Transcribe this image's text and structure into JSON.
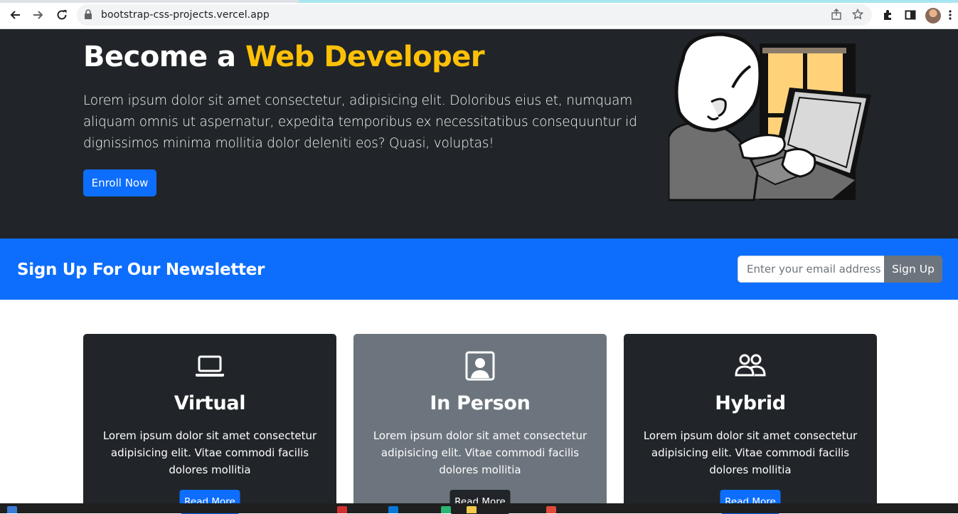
{
  "browser": {
    "url": "bootstrap-css-projects.vercel.app",
    "nav": [
      "back-icon",
      "forward-icon",
      "reload-icon"
    ],
    "toolbar_icons": [
      "share-icon",
      "star-icon",
      "extensions-icon",
      "side-panel-icon",
      "avatar",
      "menu-icon"
    ]
  },
  "hero": {
    "title_plain": "Become a ",
    "title_accent": "Web Developer",
    "lead": "Lorem ipsum dolor sit amet consectetur, adipisicing elit. Doloribus eius et, numquam aliquam omnis ut aspernatur, expedita temporibus ex necessitatibus consequuntur id dignissimos minima mollitia dolor deleniti eos? Quasi, voluptas!",
    "button": "Enroll Now",
    "accent_color": "#ffc107"
  },
  "newsletter": {
    "heading": "Sign Up For Our Newsletter",
    "placeholder": "Enter your email address",
    "button": "Sign Up"
  },
  "cards": [
    {
      "icon": "laptop-icon",
      "title": "Virtual",
      "text": "Lorem ipsum dolor sit amet consectetur adipisicing elit. Vitae commodi facilis dolores mollitia",
      "button": "Read More"
    },
    {
      "icon": "person-badge-icon",
      "title": "In Person",
      "text": "Lorem ipsum dolor sit amet consectetur adipisicing elit. Vitae commodi facilis dolores mollitia",
      "button": "Read More"
    },
    {
      "icon": "people-icon",
      "title": "Hybrid",
      "text": "Lorem ipsum dolor sit amet consectetur adipisicing elit. Vitae commodi facilis dolores mollitia",
      "button": "Read More"
    }
  ],
  "colors": {
    "dark": "#212529",
    "primary": "#0d6efd",
    "secondary": "#6c757d"
  }
}
